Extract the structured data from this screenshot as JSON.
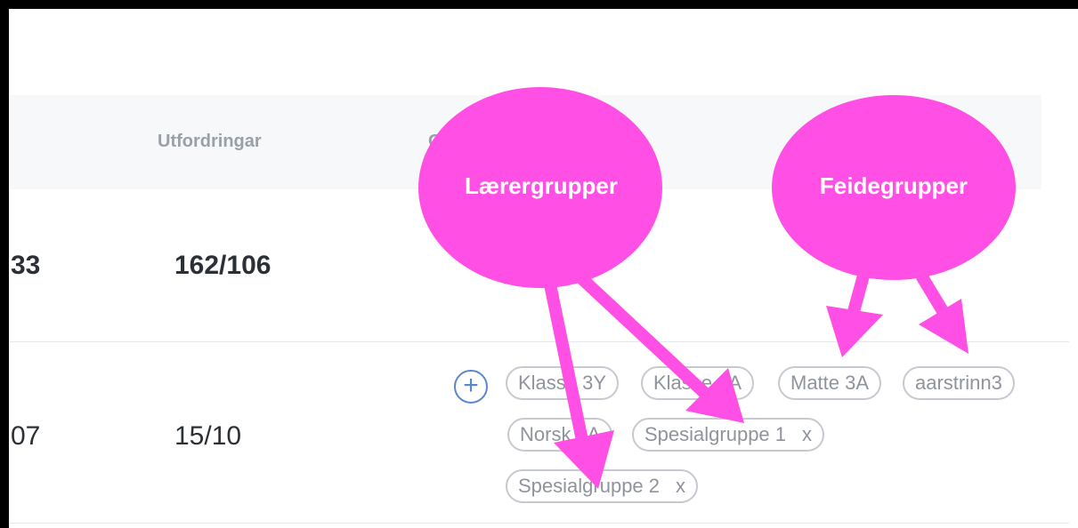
{
  "table": {
    "headers": [
      "Utfordringar",
      "G"
    ],
    "rows": [
      {
        "col_a": "33",
        "col_b": "162/106"
      },
      {
        "col_a": "07",
        "col_b": "15/10"
      }
    ]
  },
  "group_chips": [
    {
      "label": "Klasse 3Y",
      "removable": false
    },
    {
      "label": "Klasse 3A",
      "removable": false
    },
    {
      "label": "Matte 3A",
      "removable": false
    },
    {
      "label": "aarstrinn3",
      "removable": false
    },
    {
      "label": "Norsk 3A",
      "removable": false
    },
    {
      "label": "Spesialgruppe 1",
      "removable": true
    },
    {
      "label": "Spesialgruppe 2",
      "removable": true
    }
  ],
  "chip_remove_symbol": "x",
  "add_symbol": "+",
  "annotations": {
    "left_bubble": "Lærergrupper",
    "right_bubble": "Feidegrupper",
    "color": "#ff4fe4"
  },
  "colors": {
    "accent_blue": "#5a86d0",
    "chip_border": "#c6c9cf",
    "annotation": "#ff4fe4"
  }
}
